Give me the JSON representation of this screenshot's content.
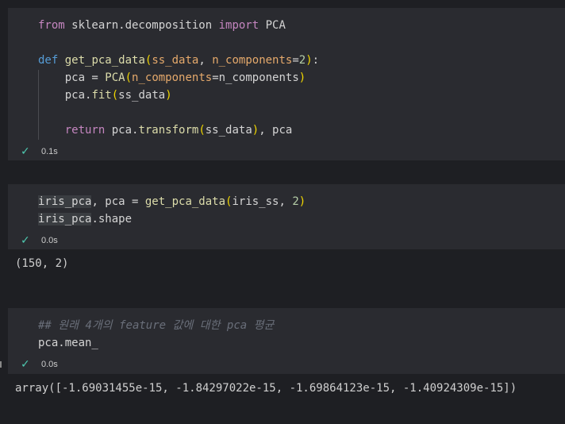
{
  "cells": [
    {
      "lines": [
        [
          {
            "t": "from",
            "c": "kw2"
          },
          {
            "t": " sklearn.decomposition "
          },
          {
            "t": "import",
            "c": "kw2"
          },
          {
            "t": " PCA"
          }
        ],
        [],
        [
          {
            "t": "def",
            "c": "kw"
          },
          {
            "t": " "
          },
          {
            "t": "get_pca_data",
            "c": "fn"
          },
          {
            "t": "(",
            "c": "paren"
          },
          {
            "t": "ss_data",
            "c": "param"
          },
          {
            "t": ", "
          },
          {
            "t": "n_components",
            "c": "param"
          },
          {
            "t": "="
          },
          {
            "t": "2",
            "c": "num"
          },
          {
            "t": ")",
            "c": "paren"
          },
          {
            "t": ":"
          }
        ],
        [
          {
            "t": "    pca = "
          },
          {
            "t": "PCA",
            "c": "fn"
          },
          {
            "t": "(",
            "c": "paren"
          },
          {
            "t": "n_components",
            "c": "param"
          },
          {
            "t": "=n_components"
          },
          {
            "t": ")",
            "c": "paren"
          }
        ],
        [
          {
            "t": "    pca."
          },
          {
            "t": "fit",
            "c": "fn"
          },
          {
            "t": "(",
            "c": "paren"
          },
          {
            "t": "ss_data"
          },
          {
            "t": ")",
            "c": "paren"
          }
        ],
        [],
        [
          {
            "t": "    "
          },
          {
            "t": "return",
            "c": "kw2"
          },
          {
            "t": " pca."
          },
          {
            "t": "transform",
            "c": "fn"
          },
          {
            "t": "(",
            "c": "paren"
          },
          {
            "t": "ss_data"
          },
          {
            "t": ")",
            "c": "paren"
          },
          {
            "t": ", pca"
          }
        ]
      ],
      "status": {
        "icon": "✓",
        "time": "0.1s"
      }
    },
    {
      "lines": [
        [
          {
            "t": "iris_pca",
            "c": "hl"
          },
          {
            "t": ", pca = "
          },
          {
            "t": "get_pca_data",
            "c": "fn"
          },
          {
            "t": "(",
            "c": "paren"
          },
          {
            "t": "iris_ss, "
          },
          {
            "t": "2",
            "c": "num"
          },
          {
            "t": ")",
            "c": "paren"
          }
        ],
        [
          {
            "t": "iris_pca",
            "c": "hl"
          },
          {
            "t": ".shape"
          }
        ]
      ],
      "status": {
        "icon": "✓",
        "time": "0.0s"
      },
      "output": "(150, 2)"
    },
    {
      "lines": [
        [
          {
            "t": "## 원래 4개의 feature 값에 대한 pca 평균",
            "c": "comment"
          }
        ],
        [
          {
            "t": "pca.mean_"
          }
        ]
      ],
      "status": {
        "icon": "✓",
        "time": "0.0s"
      },
      "output": "array([-1.69031455e-15, -1.84297022e-15, -1.69864123e-15, -1.40924309e-15])"
    }
  ]
}
